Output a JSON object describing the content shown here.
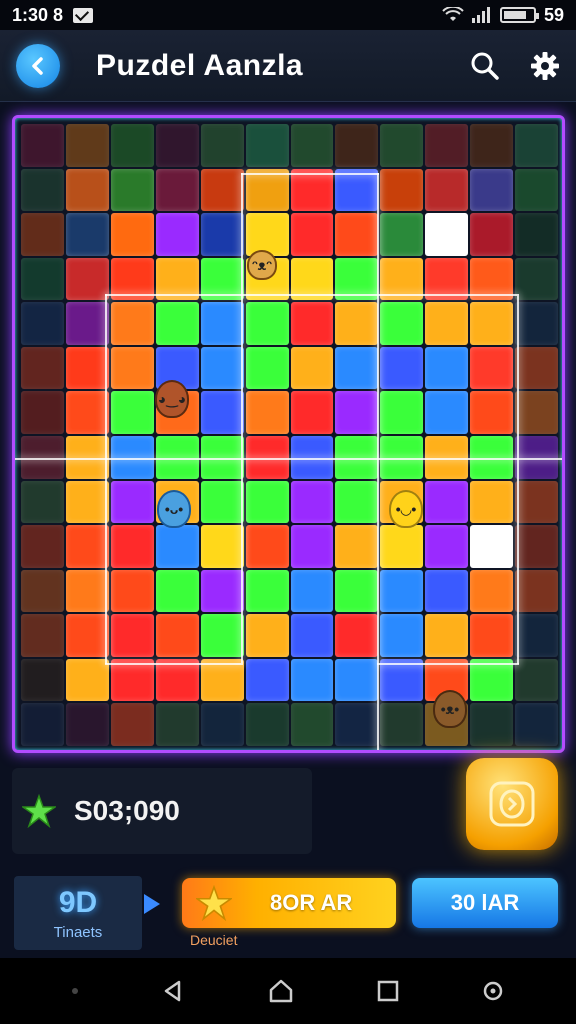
{
  "status_bar": {
    "time": "1:30 8",
    "battery_text": "59"
  },
  "header": {
    "title": "Puzdel Aanzla",
    "back_icon": "back-arrow-icon",
    "search_icon": "search-icon",
    "settings_icon": "gear-icon"
  },
  "board": {
    "columns": 12,
    "rows": 14,
    "tiles": [
      [
        "#7a1a3a",
        "#c46a10",
        "#2c8a2a",
        "#5a1a3a",
        "#3a7a3a",
        "#2a9a5a",
        "#3a8a3a",
        "#7a3a10",
        "#3a8a3a",
        "#a62a2a",
        "#7a3a10",
        "#2a7a4a"
      ],
      [
        "#2a5a3a",
        "#b8501a",
        "#2a7a2a",
        "#6a1a3a",
        "#c83a10",
        "#f0a010",
        "#ff2a2a",
        "#3a5aff",
        "#c8400a",
        "#b82a2a",
        "#3a3a8a",
        "#2a8a3a"
      ],
      [
        "#c84a10",
        "#1a3a6a",
        "#ff6a10",
        "#9a2aff",
        "#1a3aaa",
        "#ffd81a",
        "#ff2a2a",
        "#ff4a1a",
        "#2a8a3a",
        "#ffffff",
        "#aa1a2a",
        "#1a4a2a"
      ],
      [
        "#1a6a3a",
        "#c82a2a",
        "#ff3a1a",
        "#ffb01a",
        "#3aff3a",
        "#ffd81a",
        "#ffd81a",
        "#3aff3a",
        "#ffb01a",
        "#ff3a2a",
        "#ff5a1a",
        "#2a6a3a"
      ],
      [
        "#1a3a6a",
        "#6a1a8a",
        "#ff7a1a",
        "#3aff3a",
        "#2a8aff",
        "#3aff3a",
        "#ff2a2a",
        "#ffb01a",
        "#3aff3a",
        "#ffb01a",
        "#ffb01a",
        "#1a3a5a"
      ],
      [
        "#c83a1a",
        "#ff3a1a",
        "#ff7a1a",
        "#3a5aff",
        "#2a8aff",
        "#3aff3a",
        "#ffb01a",
        "#2a8aff",
        "#3a5aff",
        "#2a8aff",
        "#ff3a2a",
        "#ff5a1a"
      ],
      [
        "#a82a1a",
        "#ff4a1a",
        "#3aff3a",
        "#ff6a1a",
        "#3a5aff",
        "#ff7a1a",
        "#ff2a2a",
        "#9a2aff",
        "#3aff3a",
        "#2a8aff",
        "#ff4a1a",
        "#ff7a1a"
      ],
      [
        "#9a2a3a",
        "#ffb01a",
        "#2a8aff",
        "#3aff3a",
        "#3aff3a",
        "#ff2a2a",
        "#3a5aff",
        "#3aff3a",
        "#3aff3a",
        "#ffb01a",
        "#3aff3a",
        "#9a2aff"
      ],
      [
        "#3a6a3a",
        "#ffb01a",
        "#9a2aff",
        "#ffb01a",
        "#3aff3a",
        "#3aff3a",
        "#9a2aff",
        "#3aff3a",
        "#ffb01a",
        "#9a2aff",
        "#ffb01a",
        "#ff5a1a"
      ],
      [
        "#c83a1a",
        "#ff4a1a",
        "#ff2a2a",
        "#2a8aff",
        "#ffd81a",
        "#ff4a1a",
        "#9a2aff",
        "#ffb01a",
        "#ffd81a",
        "#9a2aff",
        "#ffffff",
        "#c83a1a"
      ],
      [
        "#c85a1a",
        "#ff7a1a",
        "#ff4a1a",
        "#3aff3a",
        "#9a2aff",
        "#3aff3a",
        "#2a8aff",
        "#3aff3a",
        "#2a8aff",
        "#3a5aff",
        "#ff7a1a",
        "#ff5a1a"
      ],
      [
        "#c84a1a",
        "#ff4a1a",
        "#ff2a2a",
        "#ff4a1a",
        "#3aff3a",
        "#ffb01a",
        "#3a5aff",
        "#ff2a2a",
        "#2a8aff",
        "#ffb01a",
        "#ff4a1a",
        "#1a3a5a"
      ],
      [
        "#3a2a1a",
        "#ffb01a",
        "#ff2a2a",
        "#ff2a2a",
        "#ffb01a",
        "#3a5aff",
        "#2a8aff",
        "#2a8aff",
        "#3a5aff",
        "#ff4a1a",
        "#3aff3a",
        "#3a6a3a"
      ],
      [
        "#1a2a4a",
        "#4a1a3a",
        "#ff4a1a",
        "#3a6a3a",
        "#1a3a5a",
        "#2a6a3a",
        "#3a8a3a",
        "#1a3a6a",
        "#3a6a3a",
        "#ffb01a",
        "#2a5a3a",
        "#1a3a5a"
      ]
    ]
  },
  "score": {
    "star_icon": "star-icon",
    "value": "S03;090"
  },
  "hint_button": {
    "icon": "puzzle-hint-icon"
  },
  "tickets": {
    "count": "9D",
    "label": "Tinaets"
  },
  "orange_button": {
    "label": "8OR AR",
    "sub_label": "Deuciet",
    "icon": "star-icon"
  },
  "blue_button": {
    "label": "30 lAR"
  },
  "nav": {
    "back_icon": "nav-back-icon",
    "home_icon": "nav-home-icon",
    "recents_icon": "nav-recents-icon",
    "extra_icon": "nav-extra-icon"
  }
}
